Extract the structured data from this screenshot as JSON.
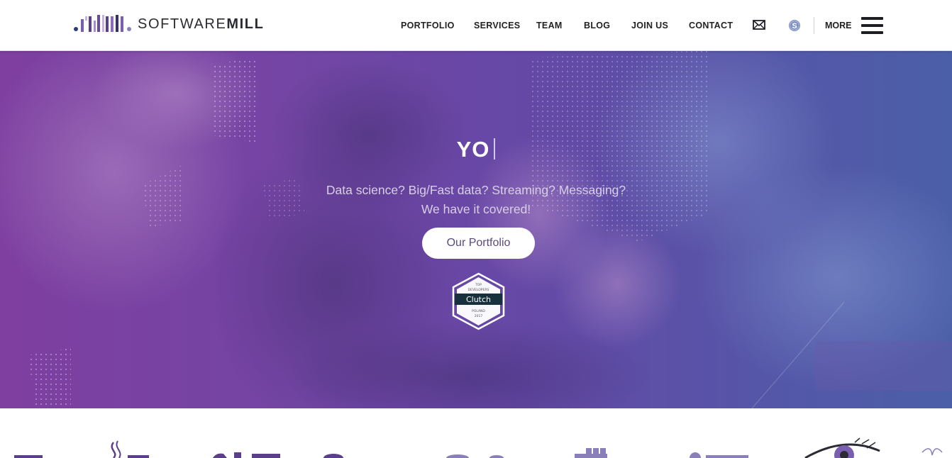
{
  "brand": {
    "name_light": "SOFTWARE",
    "name_bold": "MILL"
  },
  "nav": {
    "items": [
      {
        "id": "portfolio",
        "label": "PORTFOLIO"
      },
      {
        "id": "services",
        "label": "SERVICES"
      },
      {
        "id": "team",
        "label": "TEAM"
      },
      {
        "id": "blog",
        "label": "BLOG"
      },
      {
        "id": "join-us",
        "label": "JOIN US"
      },
      {
        "id": "contact",
        "label": "CONTACT"
      }
    ],
    "icons": [
      "mail-icon",
      "skype-icon",
      "hamburger-menu-icon"
    ],
    "more_label": "MORE"
  },
  "hero": {
    "title": "YO",
    "subtitle_line1": "Data science? Big/Fast data? Streaming? Messaging?",
    "subtitle_line2": "We have it covered!",
    "cta_label": "Our Portfolio",
    "badge": {
      "top": "TOP",
      "mid": "DEVELOPERS",
      "name": "Clutch",
      "country": "POLAND",
      "year": "2017"
    }
  },
  "colors": {
    "hero_gradient_start": "#7e3fa0",
    "hero_gradient_end": "#4b5fa8",
    "logo_purple": "#5b3f8a",
    "text_dark": "#222222"
  }
}
